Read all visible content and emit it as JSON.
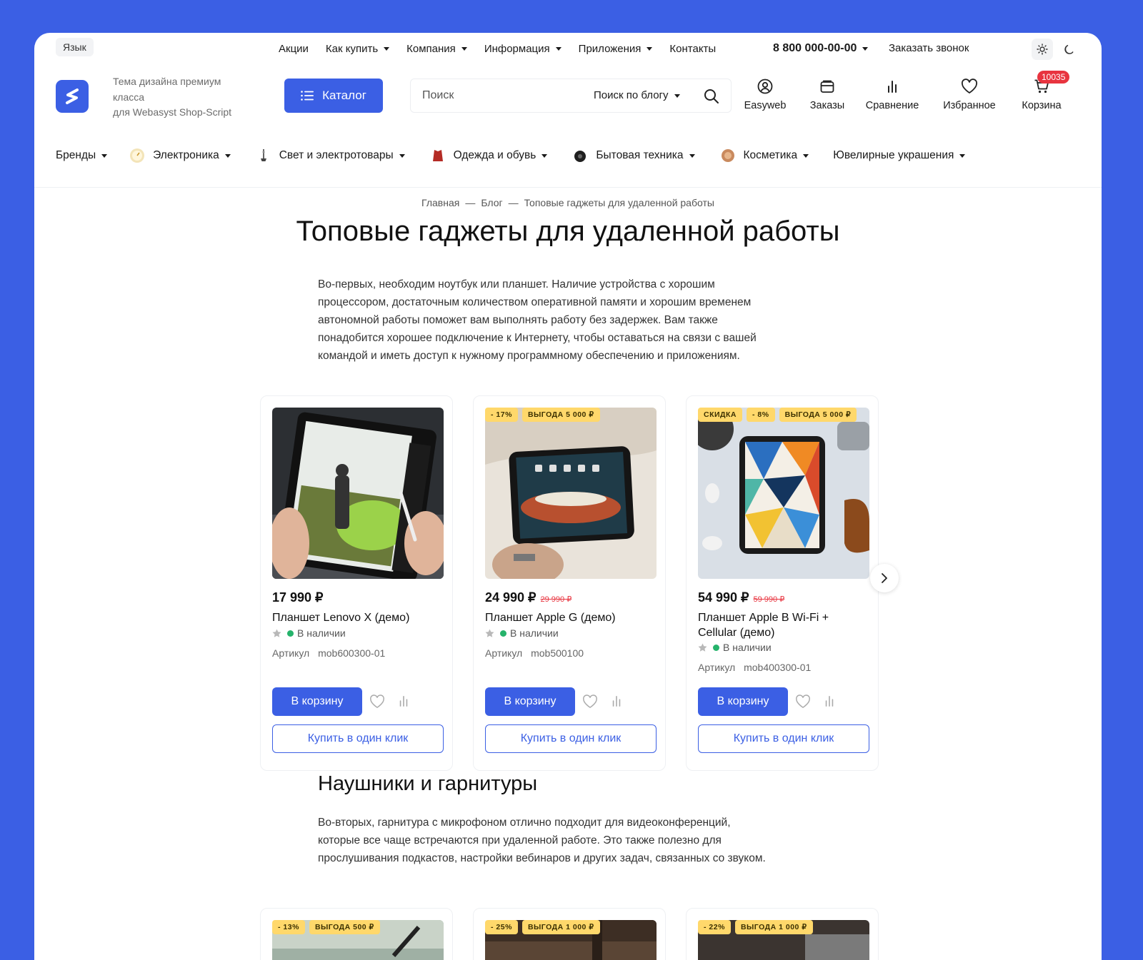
{
  "topbar": {
    "language": "Язык",
    "nav": [
      {
        "label": "Акции",
        "dropdown": false
      },
      {
        "label": "Как купить",
        "dropdown": true
      },
      {
        "label": "Компания",
        "dropdown": true
      },
      {
        "label": "Информация",
        "dropdown": true
      },
      {
        "label": "Приложения",
        "dropdown": true
      },
      {
        "label": "Контакты",
        "dropdown": false
      }
    ],
    "phone": "8 800 000-00-00",
    "callback": "Заказать звонок"
  },
  "header": {
    "tagline": [
      "Тема дизайна премиум",
      "класса",
      "для Webasyst Shop-Script"
    ],
    "catalog_label": "Каталог",
    "search_placeholder": "Поиск",
    "search_scope": "Поиск по блогу",
    "icons": {
      "account": "Easyweb",
      "orders": "Заказы",
      "compare": "Сравнение",
      "favorites": "Избранное",
      "cart": "Корзина",
      "cart_count": "10035"
    }
  },
  "categories": [
    {
      "label": "Бренды"
    },
    {
      "label": "Электроника"
    },
    {
      "label": "Свет и электротовары"
    },
    {
      "label": "Одежда и обувь"
    },
    {
      "label": "Бытовая техника"
    },
    {
      "label": "Косметика"
    },
    {
      "label": "Ювелирные украшения"
    }
  ],
  "breadcrumb": {
    "home": "Главная",
    "blog": "Блог",
    "current": "Топовые гаджеты для удаленной работы",
    "sep": "—"
  },
  "article": {
    "title": "Топовые гаджеты для удаленной работы",
    "intro": [
      "Во-первых, необходим ноутбук или планшет. Наличие устройства с хорошим",
      "процессором, достаточным количеством оперативной памяти и хорошим временем",
      "автономной работы поможет вам выполнять работу без задержек. Вам также",
      "понадобится хорошее подключение к Интернету, чтобы оставаться на связи с вашей",
      "командой и иметь доступ к нужному программному обеспечению и приложениям."
    ],
    "section2_title": "Наушники и гарнитуры",
    "section2_text": [
      "Во-вторых, гарнитура с микрофоном отлично подходит для видеоконференций,",
      "которые все чаще встречаются при удаленной работе. Это также полезно для",
      "прослушивания подкастов, настройки вебинаров и других задач, связанных со звуком."
    ]
  },
  "products": [
    {
      "badges": [],
      "price": "17 990 ₽",
      "old_price": "",
      "name": "Планшет Lenovo X (демо)",
      "stock": "В наличии",
      "sku_label": "Артикул",
      "sku": "mob600300-01",
      "cart_btn": "В корзину",
      "one_click": "Купить в один клик"
    },
    {
      "badges": [
        "- 17%",
        "ВЫГОДА 5 000 ₽"
      ],
      "price": "24 990 ₽",
      "old_price": "29 990 ₽",
      "name": "Планшет Apple G (демо)",
      "stock": "В наличии",
      "sku_label": "Артикул",
      "sku": "mob500100",
      "cart_btn": "В корзину",
      "one_click": "Купить в один клик"
    },
    {
      "badges": [
        "СКИДКА",
        "- 8%",
        "ВЫГОДА 5 000 ₽"
      ],
      "price": "54 990 ₽",
      "old_price": "59 990 ₽",
      "name": "Планшет Apple B Wi-Fi + Cellular (демо)",
      "stock": "В наличии",
      "sku_label": "Артикул",
      "sku": "mob400300-01",
      "cart_btn": "В корзину",
      "one_click": "Купить в один клик"
    }
  ],
  "products2": [
    {
      "badges": [
        "- 13%",
        "ВЫГОДА 500 ₽"
      ]
    },
    {
      "badges": [
        "- 25%",
        "ВЫГОДА 1 000 ₽"
      ]
    },
    {
      "badges": [
        "- 22%",
        "ВЫГОДА 1 000 ₽"
      ]
    }
  ],
  "colors": {
    "accent": "#3b5fe4",
    "badge": "#ffd86b",
    "sale": "#e8343f",
    "in_stock": "#25b36b"
  }
}
